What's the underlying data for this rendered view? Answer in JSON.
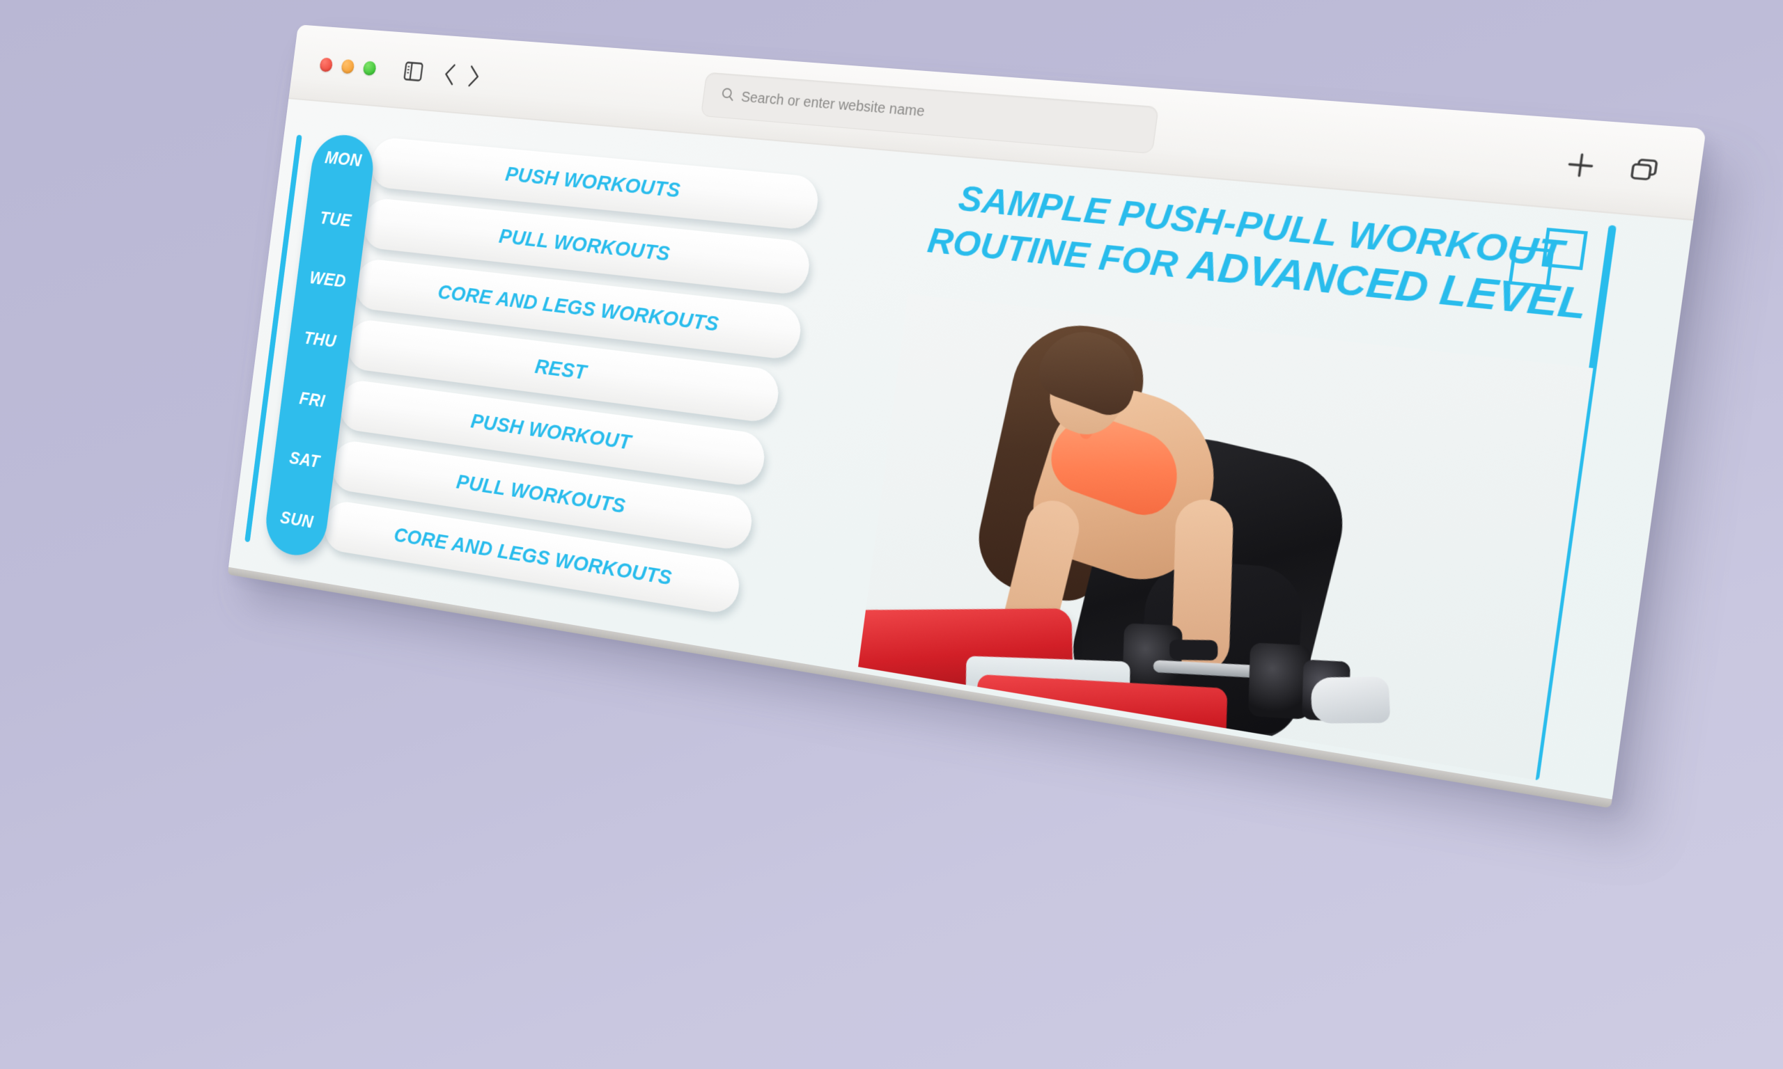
{
  "browser": {
    "traffic_lights": [
      "close",
      "minimize",
      "zoom"
    ],
    "sidebar_toggle_icon": "sidebar-toggle-icon",
    "back_icon": "chevron-left-icon",
    "forward_icon": "chevron-right-icon",
    "search": {
      "icon": "search-icon",
      "value": "",
      "placeholder": "Search or enter website name"
    },
    "new_tab_icon": "plus-icon",
    "tab_overview_icon": "tab-overview-icon"
  },
  "page": {
    "accent_color": "#29bcec",
    "background_color": "#eef4f4",
    "headline": {
      "lead": "SAMPLE PUSH-PULL WORKOUT ROUTINE FOR ",
      "strong": "ADVANCED LEVEL",
      "full": "SAMPLE PUSH-PULL WORKOUT ROUTINE FOR ADVANCED LEVEL"
    },
    "decorative": {
      "squares_icon": "overlapping-squares-icon",
      "left_rule": "vertical-accent-bar",
      "right_rule": "vertical-accent-bar"
    },
    "schedule": {
      "rows": [
        {
          "day": "MON",
          "workout": "PUSH WORKOUTS"
        },
        {
          "day": "TUE",
          "workout": "PULL WORKOUTS"
        },
        {
          "day": "WED",
          "workout": "CORE AND LEGS WORKOUTS"
        },
        {
          "day": "THU",
          "workout": "REST"
        },
        {
          "day": "FRI",
          "workout": "PUSH WORKOUT"
        },
        {
          "day": "SAT",
          "workout": "PULL WORKOUTS"
        },
        {
          "day": "SUN",
          "workout": "CORE AND LEGS WORKOUTS"
        }
      ]
    },
    "hero_photo": {
      "description": "Woman in orange sports bra and black leggings performing a one-arm dumbbell row on a red weight bench",
      "bra_color": "#ff7f52",
      "bench_color": "#d21f27",
      "leggings_color": "#141417"
    }
  }
}
